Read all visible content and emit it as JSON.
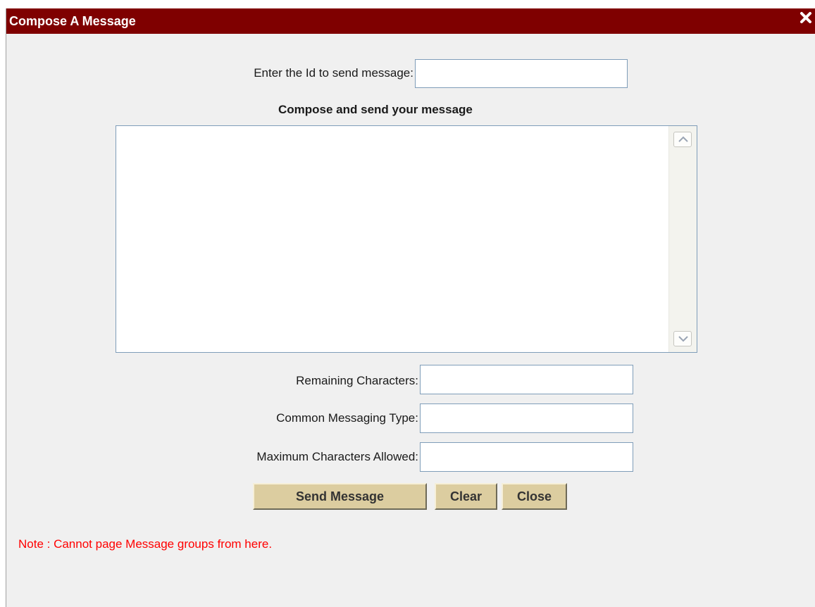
{
  "dialog": {
    "title": "Compose A Message",
    "close_icon": "close-icon",
    "accent_color": "#7f0000"
  },
  "form": {
    "id_label": "Enter the Id to send message:",
    "id_value": "",
    "compose_heading": "Compose and send your message",
    "message_value": "",
    "remaining_label": "Remaining Characters:",
    "remaining_value": "",
    "type_label": "Common Messaging Type:",
    "type_value": "",
    "max_label": "Maximum Characters Allowed:",
    "max_value": ""
  },
  "buttons": {
    "send_label": "Send Message",
    "clear_label": "Clear",
    "close_label": "Close"
  },
  "note": {
    "text": "Note : Cannot page Message groups from here.",
    "color": "#ff0000"
  }
}
